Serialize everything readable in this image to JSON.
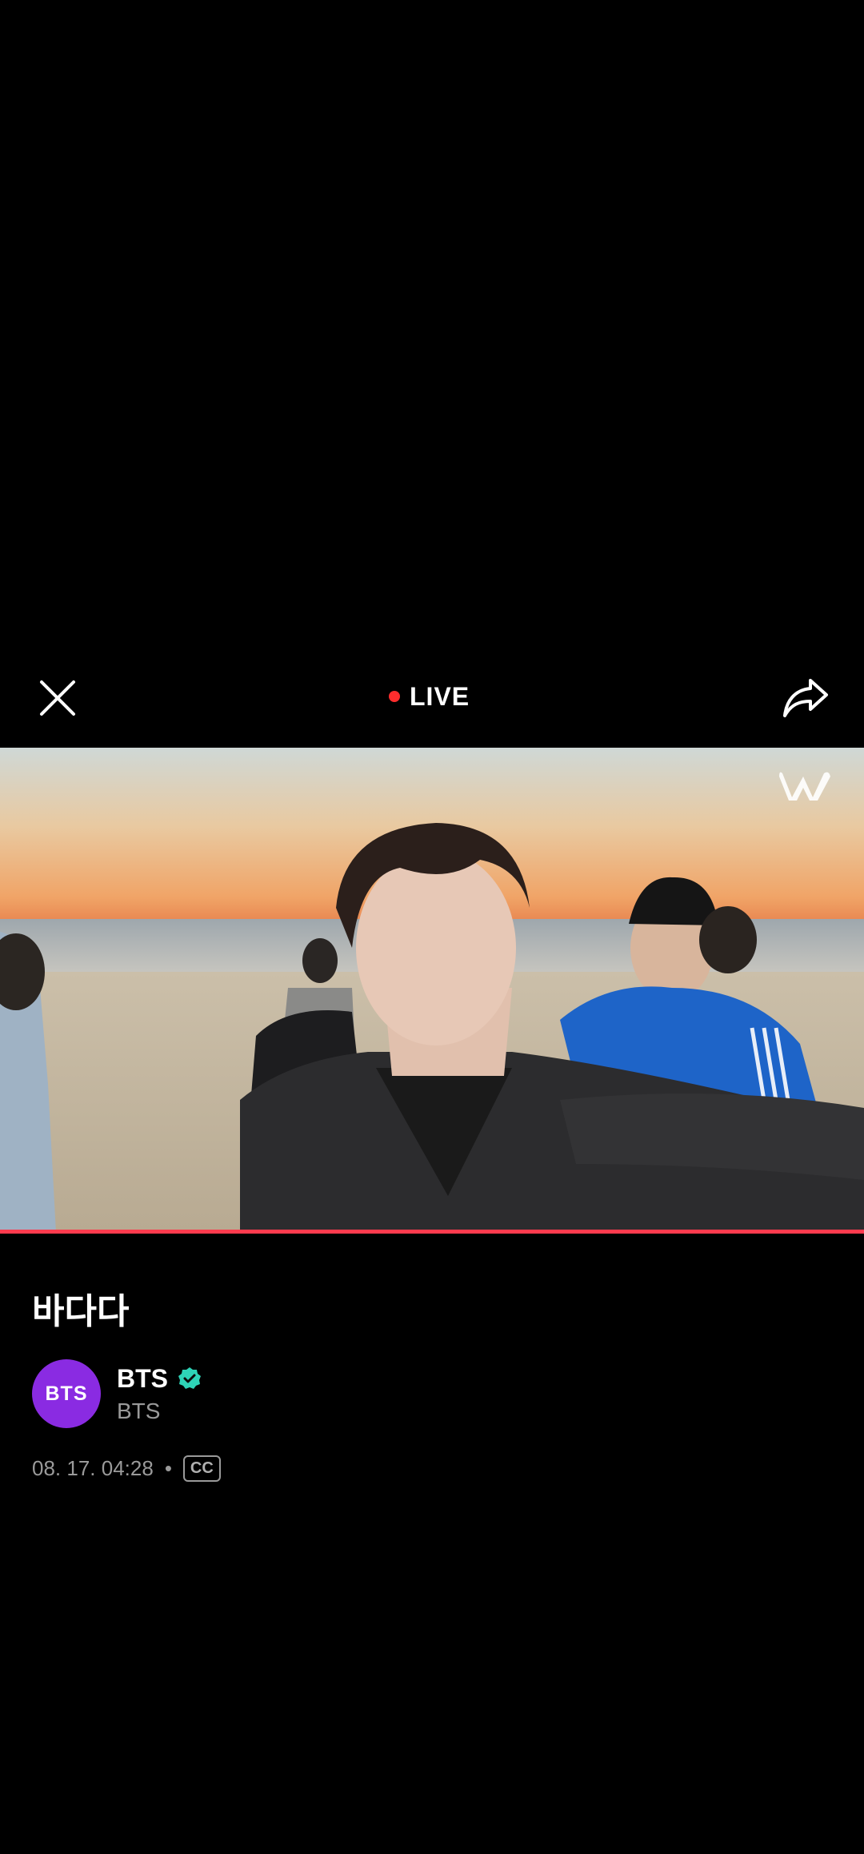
{
  "header": {
    "live_label": "LIVE",
    "close_icon": "close-icon",
    "share_icon": "share-icon"
  },
  "video": {
    "watermark": "weverse-logo",
    "progress": 1.0
  },
  "post": {
    "title": "바다다",
    "channel_name": "BTS",
    "channel_sub": "BTS",
    "avatar_text": "BTS",
    "date": "08. 17. 04:28",
    "separator": "•",
    "cc_label": "CC"
  },
  "colors": {
    "background": "#000000",
    "live_dot": "#ff2d2d",
    "progress": "#ff3b4e",
    "avatar": "#8a2be2",
    "verified": "#2ed3b7"
  }
}
